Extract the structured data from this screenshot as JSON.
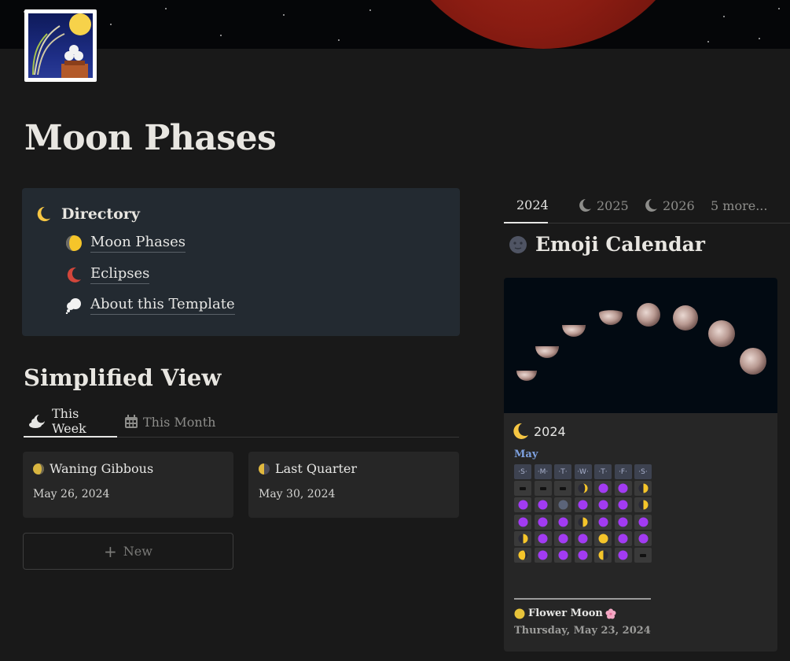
{
  "page": {
    "title": "Moon Phases",
    "icon": "moon-viewing-icon",
    "cover": "blood-moon-cover"
  },
  "directory": {
    "title": "Directory",
    "icon": "crescent-moon-icon",
    "items": [
      {
        "label": "Moon Phases",
        "icon": "waxing-gibbous-icon"
      },
      {
        "label": "Eclipses",
        "icon": "red-crescent-icon"
      },
      {
        "label": "About this Template",
        "icon": "thought-bubble-icon"
      }
    ]
  },
  "simplified": {
    "title": "Simplified View",
    "tabs": [
      {
        "label": "This Week",
        "icon": "cloud-moon-icon",
        "active": true
      },
      {
        "label": "This Month",
        "icon": "calendar-icon",
        "active": false
      }
    ],
    "cards": [
      {
        "name": "Waning Gibbous",
        "date": "May 26, 2024",
        "icon": "waning-gibbous-icon"
      },
      {
        "name": "Last Quarter",
        "date": "May 30, 2024",
        "icon": "last-quarter-icon"
      }
    ],
    "new_label": "New"
  },
  "right_tabs": [
    {
      "label": "2024",
      "active": true
    },
    {
      "label": "2025",
      "active": false
    },
    {
      "label": "2026",
      "active": false
    },
    {
      "label": "5 more...",
      "active": false
    }
  ],
  "emoji_calendar": {
    "title": "Emoji Calendar",
    "icon": "new-moon-face-icon",
    "gallery_card": {
      "year_label": "2024",
      "month": "May",
      "weekday_headers": [
        "·S·",
        "·M·",
        "·T·",
        "·W·",
        "·T·",
        "·F·",
        "·S·"
      ],
      "weeks": [
        [
          "blank",
          "blank",
          "blank",
          "waxing-crescent",
          "purple",
          "purple",
          "first-quarter"
        ],
        [
          "purple",
          "purple",
          "new-moon",
          "purple",
          "purple",
          "purple",
          "first-quarter"
        ],
        [
          "purple",
          "purple",
          "purple",
          "first-quarter",
          "purple",
          "purple",
          "purple"
        ],
        [
          "first-quarter",
          "purple",
          "purple",
          "purple",
          "full-moon",
          "purple",
          "purple"
        ],
        [
          "waning-gibbous",
          "purple",
          "purple",
          "purple",
          "last-quarter",
          "purple",
          "blank"
        ]
      ],
      "event_name": "Flower Moon",
      "event_date": "Thursday, May 23, 2024",
      "colors": {
        "purple": "#a23bf2",
        "gold": "#f5c52a",
        "new": "#5b6479"
      }
    }
  }
}
